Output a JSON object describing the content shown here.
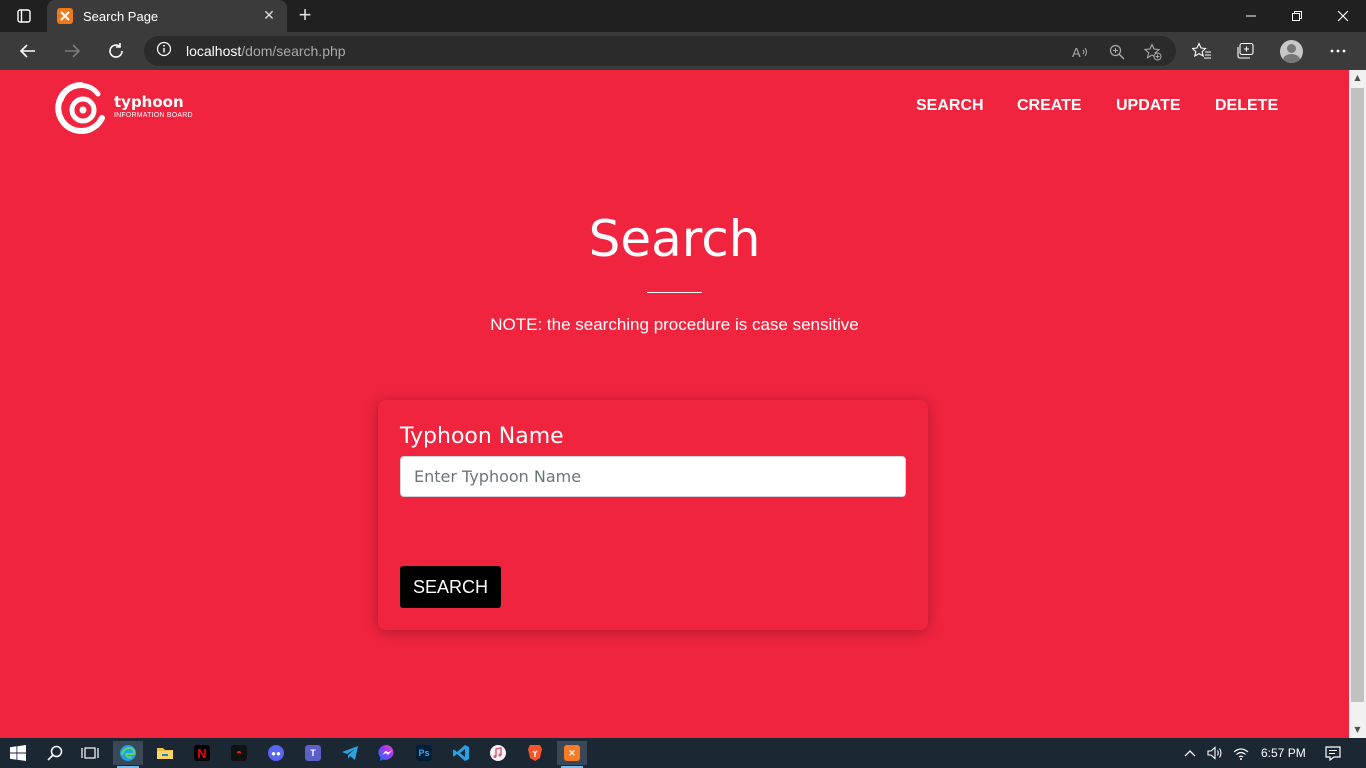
{
  "browser": {
    "tab_title": "Search Page",
    "url_host": "localhost",
    "url_path": "/dom/search.php"
  },
  "site": {
    "brand": "typhoon",
    "brand_sub": "INFORMATION BOARD",
    "nav": [
      {
        "label": "SEARCH"
      },
      {
        "label": "CREATE"
      },
      {
        "label": "UPDATE"
      },
      {
        "label": "DELETE"
      }
    ],
    "accent_color": "#f0243f"
  },
  "main": {
    "heading": "Search",
    "note": "NOTE: the searching procedure is case sensitive",
    "form": {
      "label": "Typhoon Name",
      "placeholder": "Enter Typhoon Name",
      "value": "",
      "button_label": "SEARCH"
    }
  },
  "taskbar": {
    "apps": [
      "start-icon",
      "search-icon",
      "task-view-icon",
      "edge-icon",
      "file-explorer-icon",
      "netflix-icon",
      "app-icon",
      "discord-icon",
      "teams-icon",
      "telegram-icon",
      "messenger-icon",
      "photoshop-icon",
      "vscode-icon",
      "itunes-icon",
      "brave-icon",
      "xampp-icon"
    ],
    "clock": "6:57 PM"
  }
}
